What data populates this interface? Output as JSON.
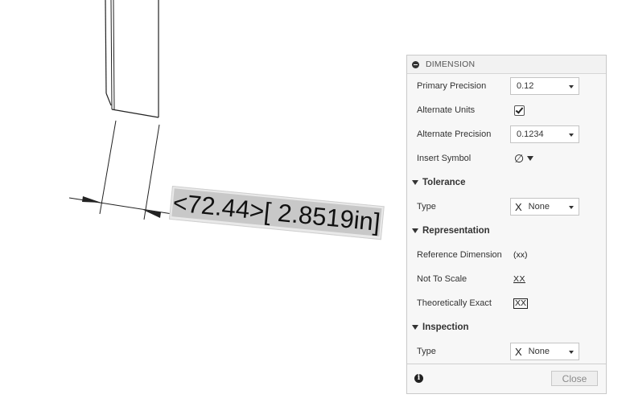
{
  "drawing": {
    "dimension_value": "<72.44>",
    "dimension_alternate": "[ 2.8519in]"
  },
  "panel": {
    "title": "DIMENSION",
    "rows": {
      "primary_precision": {
        "label": "Primary Precision",
        "value": "0.12"
      },
      "alternate_units": {
        "label": "Alternate Units",
        "checked": true
      },
      "alternate_precision": {
        "label": "Alternate Precision",
        "value": "0.1234"
      },
      "insert_symbol": {
        "label": "Insert Symbol",
        "symbol": "∅"
      }
    },
    "tolerance": {
      "heading": "Tolerance",
      "type_label": "Type",
      "type_icon": "X",
      "type_value": "None"
    },
    "representation": {
      "heading": "Representation",
      "reference_label": "Reference Dimension",
      "reference_icon": "(xx)",
      "not_to_scale_label": "Not To Scale",
      "not_to_scale_icon": "XX",
      "theoretically_exact_label": "Theoretically Exact",
      "theoretically_exact_icon": "XX"
    },
    "inspection": {
      "heading": "Inspection",
      "type_label": "Type",
      "type_icon": "X",
      "type_value": "None"
    },
    "footer": {
      "info_icon": "i",
      "close_label": "Close"
    }
  }
}
